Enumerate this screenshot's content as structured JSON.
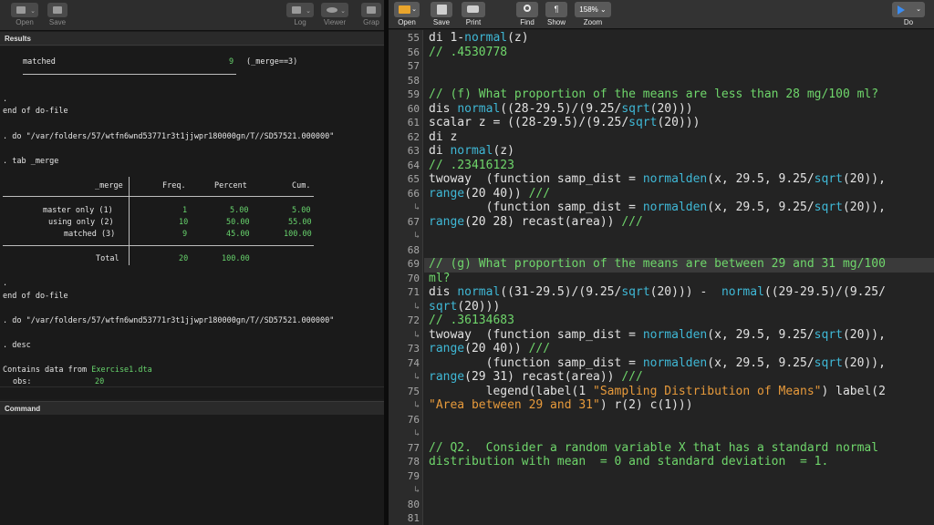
{
  "left_toolbar": {
    "buttons": [
      {
        "label": "Open",
        "icon": "folder-icon"
      },
      {
        "label": "Save",
        "icon": "save-icon"
      },
      {
        "label": "Log",
        "icon": "log-icon"
      },
      {
        "label": "Viewer",
        "icon": "viewer-icon"
      },
      {
        "label": "Grap",
        "icon": "graph-icon"
      }
    ]
  },
  "results": {
    "header": "Results",
    "merge_row": {
      "label": "matched",
      "value": "9",
      "note": "(_merge==3)"
    },
    "dot1": ".",
    "end1": "end of do-file",
    "do1": ". do \"/var/folders/57/wtfn6wnd53771r3t1jjwpr180000gn/T//SD57521.000000\"",
    "tab_cmd": ". tab _merge",
    "table": {
      "columns": [
        "_merge",
        "Freq.",
        "Percent",
        "Cum."
      ],
      "rows": [
        {
          "label": "master only (1)",
          "freq": "1",
          "percent": "5.00",
          "cum": "5.00"
        },
        {
          "label": "using only (2)",
          "freq": "10",
          "percent": "50.00",
          "cum": "55.00"
        },
        {
          "label": "matched (3)",
          "freq": "9",
          "percent": "45.00",
          "cum": "100.00"
        }
      ],
      "total": {
        "label": "Total",
        "freq": "20",
        "percent": "100.00"
      }
    },
    "dot2": ".",
    "end2": "end of do-file",
    "do2": ". do \"/var/folders/57/wtfn6wnd53771r3t1jjwpr180000gn/T//SD57521.000000\"",
    "desc_cmd": ". desc",
    "contains_prefix": "Contains data from ",
    "contains_file": "Exercise1.dta",
    "obs_label": "obs:",
    "obs_value": "20"
  },
  "command": {
    "header": "Command"
  },
  "right_toolbar": {
    "open": "Open",
    "save": "Save",
    "print": "Print",
    "find": "Find",
    "show": "Show",
    "zoom_label": "Zoom",
    "zoom_value": "158%",
    "do": "Do"
  },
  "editor": {
    "line_numbers": [
      "55",
      "56",
      "57",
      "58",
      "59",
      "60",
      "61",
      "62",
      "63",
      "64",
      "65",
      "66",
      "↳",
      "67",
      "↳",
      "68",
      "69",
      "70",
      "71",
      "↳",
      "72",
      "↳",
      "73",
      "74",
      "↳",
      "75",
      "↳",
      "76",
      "↳",
      "77",
      "78",
      "79",
      "↳",
      "80",
      "81"
    ],
    "lines": [
      [
        {
          "t": "di 1-"
        },
        {
          "t": "normal",
          "c": "fn"
        },
        {
          "t": "(z)"
        }
      ],
      [
        {
          "t": "// .4530778",
          "c": "cm"
        }
      ],
      [],
      [],
      [
        {
          "t": "// (f) What proportion of the means are less than 28 mg/100 ml?",
          "c": "cm"
        }
      ],
      [
        {
          "t": "dis "
        },
        {
          "t": "normal",
          "c": "fn"
        },
        {
          "t": "((28-29.5)/(9.25/"
        },
        {
          "t": "sqrt",
          "c": "fn"
        },
        {
          "t": "(20)))"
        }
      ],
      [
        {
          "t": "scalar z = ((28-29.5)/(9.25/"
        },
        {
          "t": "sqrt",
          "c": "fn"
        },
        {
          "t": "(20)))"
        }
      ],
      [
        {
          "t": "di z"
        }
      ],
      [
        {
          "t": "di "
        },
        {
          "t": "normal",
          "c": "fn"
        },
        {
          "t": "(z)"
        }
      ],
      [
        {
          "t": "// .23416123",
          "c": "cm"
        }
      ],
      [
        {
          "t": "twoway  (function samp_dist = "
        },
        {
          "t": "normalden",
          "c": "fn"
        },
        {
          "t": "(x, 29.5, 9.25/"
        },
        {
          "t": "sqrt",
          "c": "fn"
        },
        {
          "t": "(20)),"
        }
      ],
      [
        {
          "t": "range",
          "c": "fn"
        },
        {
          "t": "(20 40)) "
        },
        {
          "t": "///",
          "c": "cm"
        }
      ],
      [
        {
          "t": "        (function samp_dist = "
        },
        {
          "t": "normalden",
          "c": "fn"
        },
        {
          "t": "(x, 29.5, 9.25/"
        },
        {
          "t": "sqrt",
          "c": "fn"
        },
        {
          "t": "(20)),"
        }
      ],
      [
        {
          "t": "range",
          "c": "fn"
        },
        {
          "t": "(20 28) recast(area)) "
        },
        {
          "t": "///",
          "c": "cm"
        }
      ],
      [],
      [],
      [
        {
          "t": "// (g) What proportion of the means are between 29 and 31 mg/100",
          "c": "cm"
        }
      ],
      [
        {
          "t": "ml?",
          "c": "cm"
        }
      ],
      [
        {
          "t": "dis "
        },
        {
          "t": "normal",
          "c": "fn"
        },
        {
          "t": "((31-29.5)/(9.25/"
        },
        {
          "t": "sqrt",
          "c": "fn"
        },
        {
          "t": "(20))) -  "
        },
        {
          "t": "normal",
          "c": "fn"
        },
        {
          "t": "((29-29.5)/(9.25/"
        }
      ],
      [
        {
          "t": "sqrt",
          "c": "fn"
        },
        {
          "t": "(20)))"
        }
      ],
      [
        {
          "t": "// .36134683",
          "c": "cm"
        }
      ],
      [
        {
          "t": "twoway  (function samp_dist = "
        },
        {
          "t": "normalden",
          "c": "fn"
        },
        {
          "t": "(x, 29.5, 9.25/"
        },
        {
          "t": "sqrt",
          "c": "fn"
        },
        {
          "t": "(20)),"
        }
      ],
      [
        {
          "t": "range",
          "c": "fn"
        },
        {
          "t": "(20 40)) "
        },
        {
          "t": "///",
          "c": "cm"
        }
      ],
      [
        {
          "t": "        (function samp_dist = "
        },
        {
          "t": "normalden",
          "c": "fn"
        },
        {
          "t": "(x, 29.5, 9.25/"
        },
        {
          "t": "sqrt",
          "c": "fn"
        },
        {
          "t": "(20)),"
        }
      ],
      [
        {
          "t": "range",
          "c": "fn"
        },
        {
          "t": "(29 31) recast(area)) "
        },
        {
          "t": "///",
          "c": "cm"
        }
      ],
      [
        {
          "t": "        legend(label(1 "
        },
        {
          "t": "\"Sampling Distribution of Means\"",
          "c": "st"
        },
        {
          "t": ") label(2"
        }
      ],
      [
        {
          "t": "\"Area between 29 and 31\"",
          "c": "st"
        },
        {
          "t": ") r(2) c(1)))"
        }
      ],
      [],
      [],
      [
        {
          "t": "// Q2.  Consider a random variable X that has a standard normal",
          "c": "cm"
        }
      ],
      [
        {
          "t": "distribution with mean  = 0 and standard deviation  = 1.",
          "c": "cm"
        }
      ],
      [],
      []
    ]
  }
}
